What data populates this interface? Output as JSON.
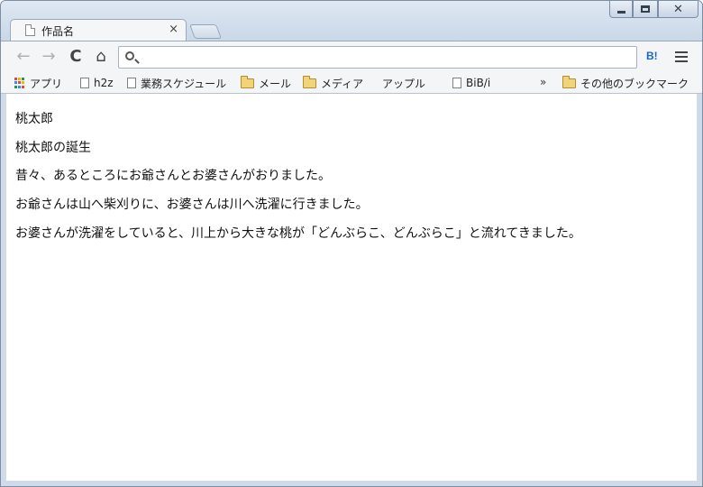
{
  "tab": {
    "title": "作品名",
    "close": "×"
  },
  "window_controls": {
    "close": "✕"
  },
  "toolbar": {
    "back": "←",
    "forward": "→",
    "reload": "C",
    "home": "⌂",
    "address_value": "",
    "extension_label": "B!"
  },
  "bookmarks": {
    "items": [
      {
        "label": "アプリ",
        "icon": "apps-icon"
      },
      {
        "label": "h2z",
        "icon": "page-icon"
      },
      {
        "label": "業務スケジュール",
        "icon": "page-icon"
      },
      {
        "label": "メール",
        "icon": "folder-icon"
      },
      {
        "label": "メディア",
        "icon": "folder-icon"
      },
      {
        "label": "アップル",
        "icon": "apple-icon"
      },
      {
        "label": "BiB/i",
        "icon": "page-icon"
      }
    ],
    "overflow": "»",
    "other": "その他のブックマーク"
  },
  "content": {
    "title": "桃太郎",
    "heading": "桃太郎の誕生",
    "lines": [
      "昔々、あるところにお爺さんとお婆さんがおりました。",
      "お爺さんは山へ柴刈りに、お婆さんは川へ洗濯に行きました。",
      "お婆さんが洗濯をしていると、川上から大きな桃が「どんぶらこ、どんぶらこ」と流れてきました。"
    ]
  },
  "colors": {
    "frame": "#cfdbe9",
    "toolbar": "#f3f5f7",
    "folder": "#f2d27a",
    "accent": "#1a66c2"
  }
}
